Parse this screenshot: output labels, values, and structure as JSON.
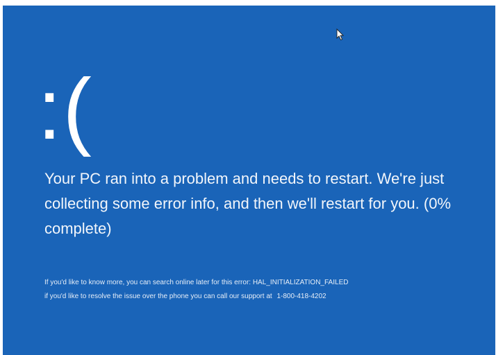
{
  "screen": {
    "background_color": "#1a64b8",
    "text_color": "#ffffff"
  },
  "sad_face": ":(",
  "message": "Your PC ran into a problem and needs to restart. We're just collecting some error info, and then we'll restart for you. (0% complete)",
  "details": {
    "search_line": "If you'd like to know more, you can search online later for this error: HAL_INITIALIZATION_FAILED",
    "phone_line": "if you'd like to resolve the issue over the phone you can call our support at",
    "phone_number": "1-800-418-4202"
  },
  "cursor_icon": "mouse-pointer-icon"
}
